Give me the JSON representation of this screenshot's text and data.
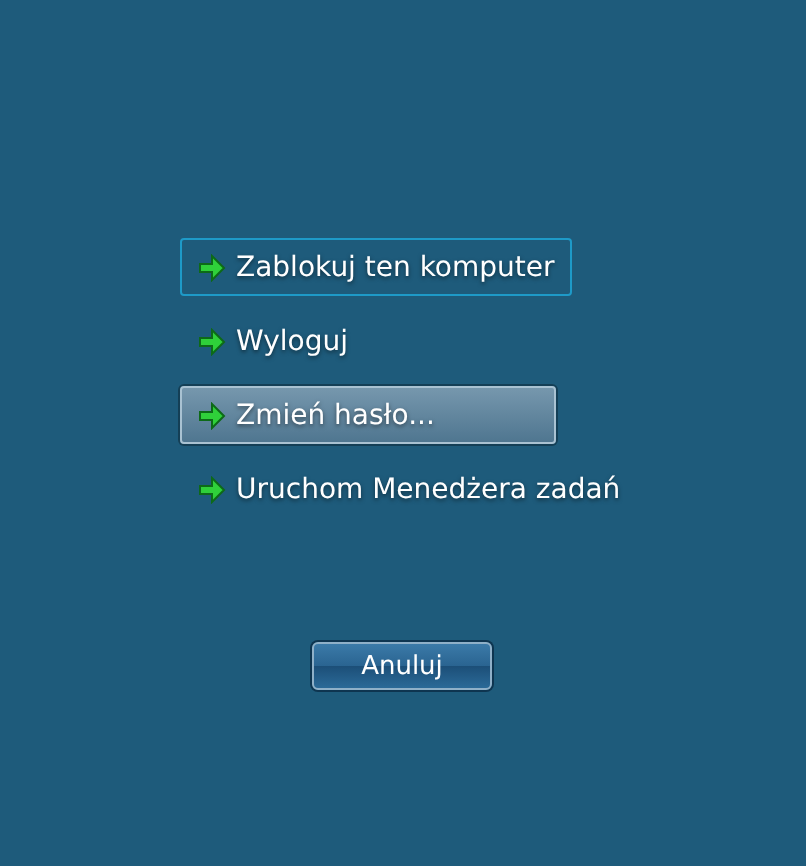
{
  "options": [
    {
      "label": "Zablokuj ten komputer",
      "focused": true,
      "selected": false
    },
    {
      "label": "Wyloguj",
      "focused": false,
      "selected": false
    },
    {
      "label": "Zmień hasło...",
      "focused": false,
      "selected": true
    },
    {
      "label": "Uruchom Menedżera zadań",
      "focused": false,
      "selected": false
    }
  ],
  "cancel_button": "Anuluj"
}
